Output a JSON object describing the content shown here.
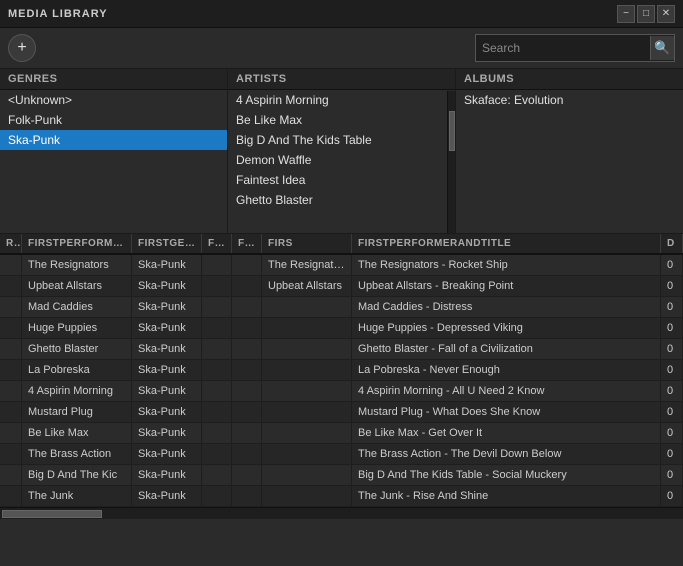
{
  "titleBar": {
    "title": "MEDIA LIBRARY",
    "controls": {
      "minimize": "−",
      "maximize": "□",
      "close": "✕"
    }
  },
  "toolbar": {
    "addButton": "+",
    "search": {
      "placeholder": "Search",
      "icon": "🔍"
    }
  },
  "columns": {
    "genres": {
      "header": "Genres",
      "items": [
        {
          "label": "<Unknown>",
          "selected": false
        },
        {
          "label": "Folk-Punk",
          "selected": false
        },
        {
          "label": "Ska-Punk",
          "selected": true
        }
      ]
    },
    "artists": {
      "header": "Artists",
      "items": [
        {
          "label": "4 Aspirin Morning",
          "selected": false
        },
        {
          "label": "Be Like Max",
          "selected": false
        },
        {
          "label": "Big D And The Kids Table",
          "selected": false
        },
        {
          "label": "Demon Waffle",
          "selected": false
        },
        {
          "label": "Faintest Idea",
          "selected": false
        },
        {
          "label": "Ghetto Blaster",
          "selected": false
        }
      ]
    },
    "albums": {
      "header": "Albums",
      "items": [
        {
          "label": "Skaface: Evolution",
          "selected": false
        }
      ]
    }
  },
  "table": {
    "headers": [
      {
        "id": "rt",
        "label": "RT"
      },
      {
        "id": "fp",
        "label": "FIRSTPERFORMER"
      },
      {
        "id": "fg",
        "label": "FIRSTGENRE"
      },
      {
        "id": "fir1",
        "label": "FIR"
      },
      {
        "id": "fir2",
        "label": "FIR"
      },
      {
        "id": "firs",
        "label": "FIRS"
      },
      {
        "id": "fpat",
        "label": "FIRSTPERFORMERANDTITLE"
      },
      {
        "id": "d",
        "label": "D"
      }
    ],
    "rows": [
      {
        "rt": "",
        "fp": "The Resignators",
        "fg": "Ska-Punk",
        "fir1": "",
        "fir2": "",
        "firs": "The Resignators",
        "fpat": "The Resignators - Rocket Ship",
        "d": "0"
      },
      {
        "rt": "",
        "fp": "Upbeat Allstars",
        "fg": "Ska-Punk",
        "fir1": "",
        "fir2": "",
        "firs": "Upbeat Allstars",
        "fpat": "Upbeat Allstars - Breaking Point",
        "d": "0"
      },
      {
        "rt": "",
        "fp": "Mad Caddies",
        "fg": "Ska-Punk",
        "fir1": "",
        "fir2": "",
        "firs": "",
        "fpat": "Mad Caddies - Distress",
        "d": "0"
      },
      {
        "rt": "",
        "fp": "Huge Puppies",
        "fg": "Ska-Punk",
        "fir1": "",
        "fir2": "",
        "firs": "",
        "fpat": "Huge Puppies - Depressed Viking",
        "d": "0"
      },
      {
        "rt": "",
        "fp": "Ghetto Blaster",
        "fg": "Ska-Punk",
        "fir1": "",
        "fir2": "",
        "firs": "",
        "fpat": "Ghetto Blaster - Fall of a Civilization",
        "d": "0"
      },
      {
        "rt": "",
        "fp": "La Pobreska",
        "fg": "Ska-Punk",
        "fir1": "",
        "fir2": "",
        "firs": "",
        "fpat": "La Pobreska - Never Enough",
        "d": "0"
      },
      {
        "rt": "",
        "fp": "4 Aspirin Morning",
        "fg": "Ska-Punk",
        "fir1": "",
        "fir2": "",
        "firs": "",
        "fpat": "4 Aspirin Morning - All U Need 2 Know",
        "d": "0"
      },
      {
        "rt": "",
        "fp": "Mustard Plug",
        "fg": "Ska-Punk",
        "fir1": "",
        "fir2": "",
        "firs": "",
        "fpat": "Mustard Plug - What Does She Know",
        "d": "0"
      },
      {
        "rt": "",
        "fp": "Be Like Max",
        "fg": "Ska-Punk",
        "fir1": "",
        "fir2": "",
        "firs": "",
        "fpat": "Be Like Max - Get Over It",
        "d": "0"
      },
      {
        "rt": "",
        "fp": "The Brass Action",
        "fg": "Ska-Punk",
        "fir1": "",
        "fir2": "",
        "firs": "",
        "fpat": "The Brass Action - The Devil Down Below",
        "d": "0"
      },
      {
        "rt": "",
        "fp": "Big D And The Kic",
        "fg": "Ska-Punk",
        "fir1": "",
        "fir2": "",
        "firs": "",
        "fpat": "Big D And The Kids Table - Social Muckery",
        "d": "0"
      },
      {
        "rt": "",
        "fp": "The Junk",
        "fg": "Ska-Punk",
        "fir1": "",
        "fir2": "",
        "firs": "",
        "fpat": "The Junk - Rise And Shine",
        "d": "0"
      }
    ]
  }
}
